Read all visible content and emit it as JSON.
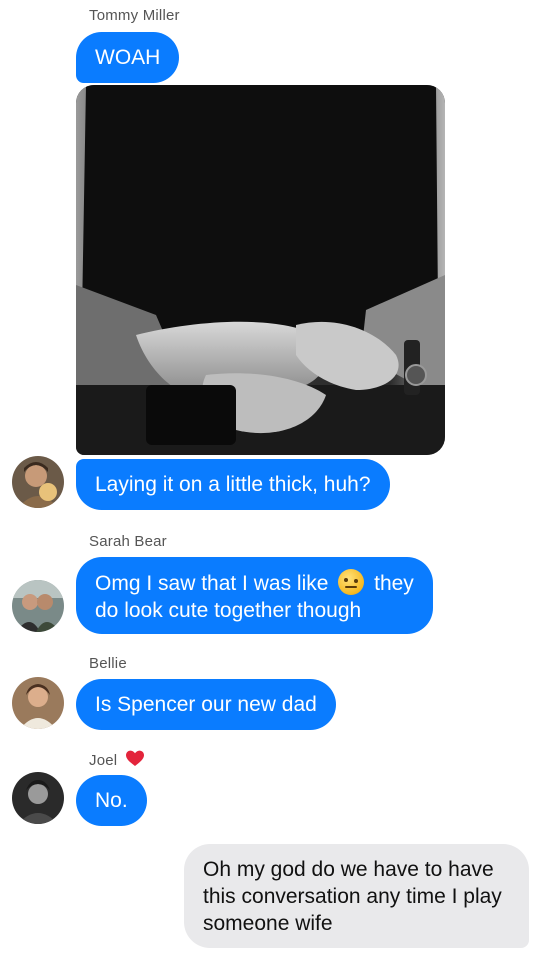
{
  "messages": {
    "tommy_name": "Tommy Miller",
    "tommy_msg1": "WOAH",
    "tommy_msg2": "Laying it on a little thick, huh?",
    "sarah_name": "Sarah Bear",
    "sarah_line1_a": "Omg I saw that I was like",
    "sarah_line1_b": "they",
    "sarah_line2": "do look cute together though",
    "bellie_name": "Bellie",
    "bellie_msg": "Is Spencer our new dad",
    "joel_name": "Joel",
    "joel_msg": "No.",
    "me_line1": "Oh my god do we have to have",
    "me_line2": "this conversation any time I play",
    "me_line3": "someone wife"
  },
  "icons": {
    "heart": "red-heart-icon",
    "emoji": "raised-eyebrow-emoji"
  },
  "colors": {
    "incoming_bubble": "#0a7cff",
    "outgoing_bubble": "#e9e9eb",
    "heart": "#e3243b"
  }
}
